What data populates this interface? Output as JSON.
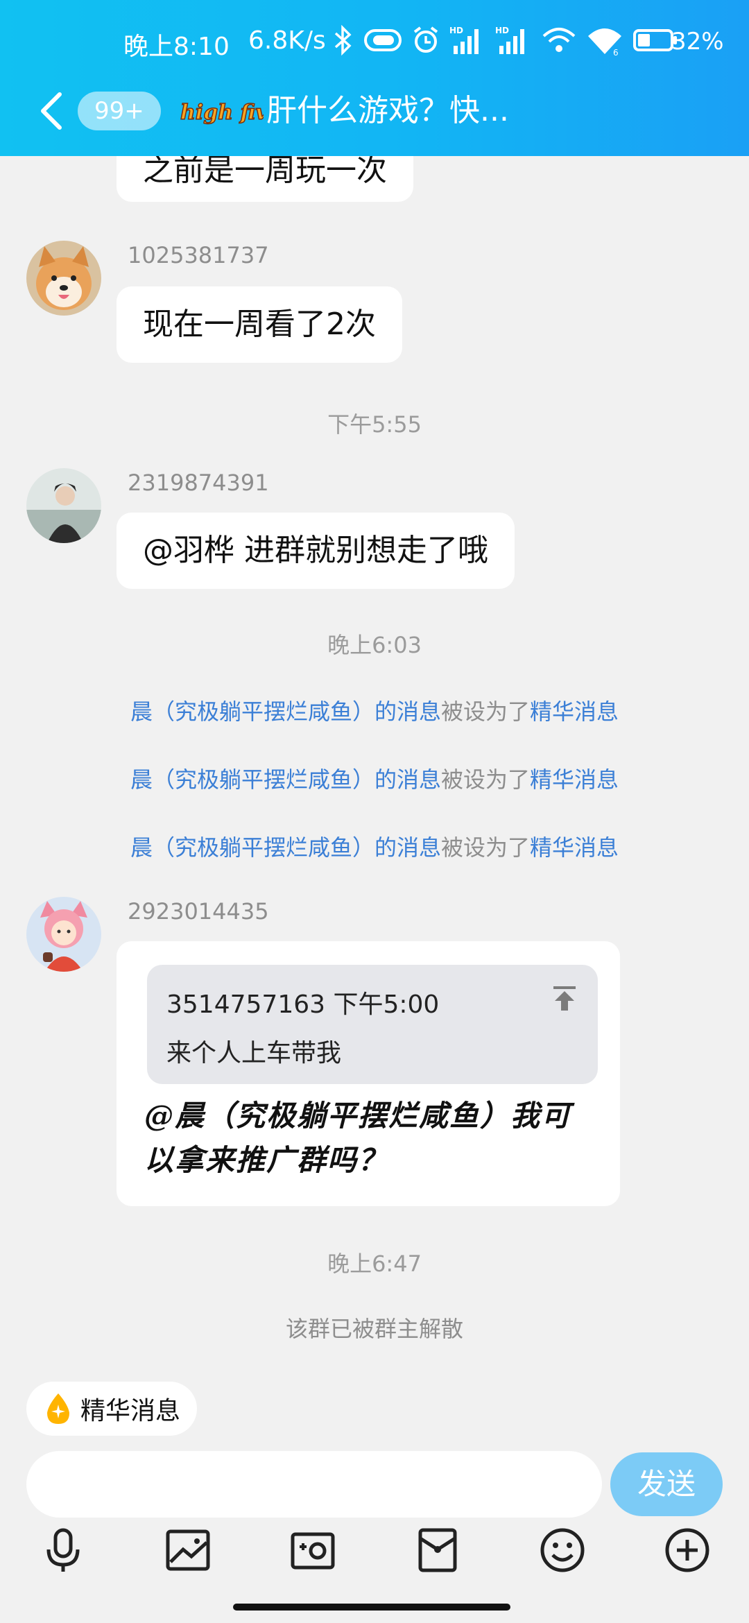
{
  "status_bar": {
    "time": "晚上8:10",
    "net_speed": "6.8K/s",
    "battery": "32%",
    "icons": [
      "bluetooth-icon",
      "toggle-icon",
      "alarm-icon",
      "hd-signal-icon",
      "hd-signal-icon",
      "wifi-sync-icon",
      "wifi-icon",
      "battery-icon"
    ]
  },
  "header": {
    "unread_badge": "99+",
    "logo_text": "high five",
    "title": "肝什么游戏？快..."
  },
  "messages": [
    {
      "text": "之前是一周玩一次"
    },
    {
      "sender": "1025381737",
      "text": "现在一周看了2次"
    },
    {
      "time": "下午5:55"
    },
    {
      "sender": "2319874391",
      "text": "@羽桦 进群就别想走了哦"
    },
    {
      "time": "晚上6:03"
    },
    {
      "system": {
        "link": "晨（究极躺平摆烂咸鱼）的消息",
        "plain": "被设为了",
        "link2": "精华消息"
      }
    },
    {
      "system": {
        "link": "晨（究极躺平摆烂咸鱼）的消息",
        "plain": "被设为了",
        "link2": "精华消息"
      }
    },
    {
      "system": {
        "link": "晨（究极躺平摆烂咸鱼）的消息",
        "plain": "被设为了",
        "link2": "精华消息"
      }
    },
    {
      "sender": "2923014435",
      "reply": {
        "meta": "3514757163 下午5:00",
        "text": "来个人上车带我"
      },
      "text_line1": "@晨（究极躺平摆烂咸鱼）我可",
      "text_line2": "以拿来推广群吗？"
    },
    {
      "time": "晚上6:47"
    },
    {
      "notice": "该群已被群主解散"
    }
  ],
  "bottom": {
    "essence_chip": "精华消息",
    "input_placeholder": "",
    "send_label": "发送",
    "tools": [
      "microphone-icon",
      "image-icon",
      "camera-icon",
      "red-packet-icon",
      "emoji-icon",
      "plus-icon"
    ]
  },
  "colors": {
    "header": "#12b5f4",
    "link": "#3b7fd6",
    "send_button": "#7ccbf6",
    "background": "#f1f1f1"
  }
}
